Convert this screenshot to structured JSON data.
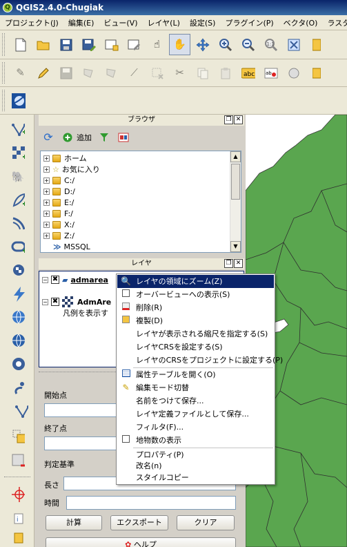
{
  "window": {
    "title": "QGIS2.4.0-Chugiak"
  },
  "menubar": [
    "プロジェクト(J)",
    "編集(E)",
    "ビュー(V)",
    "レイヤ(L)",
    "設定(S)",
    "プラグイン(P)",
    "ベクタ(O)",
    "ラスタ(R)"
  ],
  "browser": {
    "title": "ブラウザ",
    "add_label": "追加",
    "items": [
      "ホーム",
      "お気に入り",
      "C:/",
      "D:/",
      "E:/",
      "F:/",
      "X:/",
      "Z:/",
      "MSSQL"
    ]
  },
  "layers": {
    "title": "レイヤ",
    "row1": "admarea",
    "row2": "AdmAre",
    "row3": "凡例を表示す"
  },
  "context_menu": {
    "items": [
      "レイヤの領域にズーム(Z)",
      "オーバービューへの表示(S)",
      "削除(R)",
      "複製(D)",
      "レイヤが表示される縮尺を指定する(S)",
      "レイヤCRSを設定する(S)",
      "レイヤのCRSをプロジェクトに設定する(P)",
      "属性テーブルを開く(O)",
      "編集モード切替",
      "名前をつけて保存...",
      "レイヤ定義ファイルとして保存...",
      "フィルタ(F)...",
      "地物数の表示",
      "プロパティ(P)",
      "改名(n)",
      "スタイルコピー"
    ]
  },
  "measure": {
    "start_label": "開始点",
    "end_label": "終了点",
    "criteria_label": "判定基準",
    "length_label": "長さ",
    "time_label": "時間",
    "calc_button": "計算",
    "export_button": "エクスポート",
    "clear_button": "クリア",
    "help_button": "ヘルプ",
    "start_value": "",
    "end_value": "",
    "length_value": "",
    "time_value": ""
  },
  "colors": {
    "map_fill": "#5aa64f",
    "highlight": "#0a246a"
  }
}
